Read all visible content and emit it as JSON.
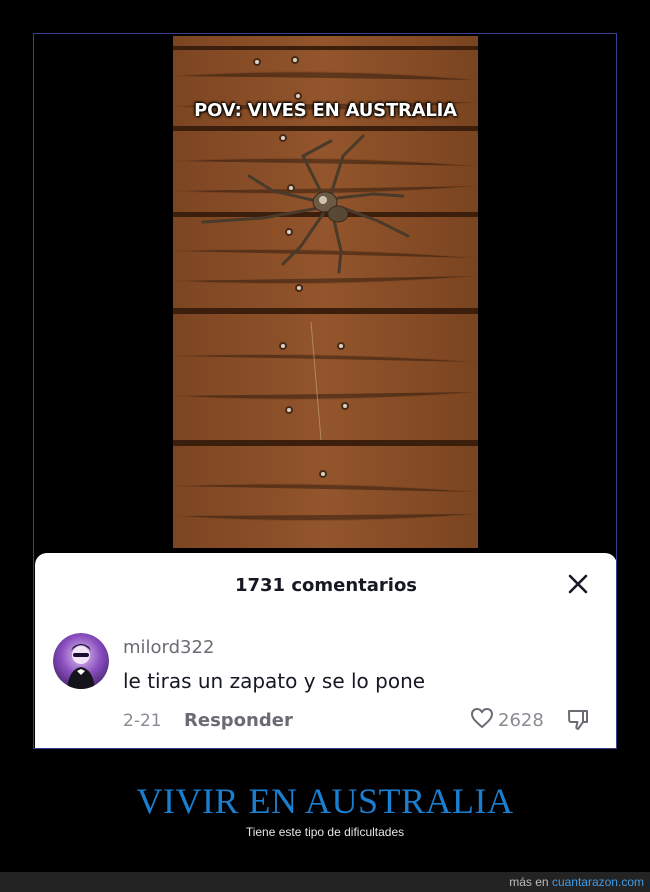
{
  "video": {
    "overlay_text": "POV: VIVES EN AUSTRALIA",
    "image": "spider on wooden deck"
  },
  "comments_panel": {
    "title": "1731 comentarios",
    "close_icon": "close-icon"
  },
  "comment": {
    "avatar": "user-avatar",
    "username": "milord322",
    "text": "le tiras un zapato y se lo pone",
    "date": "2-21",
    "reply_label": "Responder",
    "likes": "2628",
    "like_icon": "heart-icon",
    "dislike_icon": "thumbs-down-icon"
  },
  "caption": {
    "title": "VIVIR EN AUSTRALIA",
    "subtitle": "Tiene este tipo de dificultades"
  },
  "footer": {
    "prefix": "más en",
    "link": "cuantarazon.com"
  },
  "colors": {
    "caption_title": "#1a7fd1",
    "footer_link": "#3f9be6",
    "wood": "#8a4f27"
  }
}
